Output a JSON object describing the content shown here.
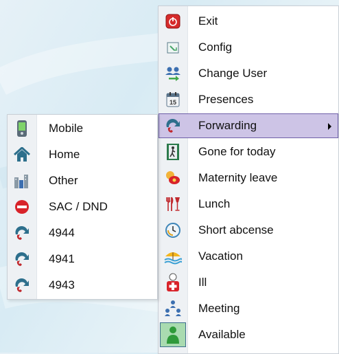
{
  "main_menu": {
    "items": [
      {
        "label": "Exit",
        "icon": "power-icon"
      },
      {
        "label": "Config",
        "icon": "config-icon"
      },
      {
        "label": "Change User",
        "icon": "change-user-icon"
      },
      {
        "label": "Presences",
        "icon": "calendar-icon",
        "icon_text": "15"
      },
      {
        "label": "Forwarding",
        "icon": "forwarding-phone-icon",
        "highlighted": true,
        "has_submenu": true
      },
      {
        "label": "Gone for today",
        "icon": "exit-door-icon"
      },
      {
        "label": "Maternity leave",
        "icon": "pacifier-icon"
      },
      {
        "label": "Lunch",
        "icon": "cutlery-icon"
      },
      {
        "label": "Short abcense",
        "icon": "clock-icon"
      },
      {
        "label": "Vacation",
        "icon": "beach-umbrella-icon"
      },
      {
        "label": "Ill",
        "icon": "medical-cross-icon"
      },
      {
        "label": "Meeting",
        "icon": "meeting-people-icon"
      },
      {
        "label": "Available",
        "icon": "available-person-icon",
        "selected": true
      }
    ]
  },
  "sub_menu": {
    "items": [
      {
        "label": "Mobile",
        "icon": "mobile-phone-icon"
      },
      {
        "label": "Home",
        "icon": "home-icon"
      },
      {
        "label": "Other",
        "icon": "buildings-icon"
      },
      {
        "label": "SAC / DND",
        "icon": "do-not-disturb-icon"
      },
      {
        "label": "4944",
        "icon": "forwarding-phone-icon"
      },
      {
        "label": "4941",
        "icon": "forwarding-phone-icon"
      },
      {
        "label": "4943",
        "icon": "forwarding-phone-icon"
      }
    ]
  },
  "colors": {
    "highlight": "#cdc4e6",
    "highlight_border": "#6e5fa8",
    "selected_icon_bg": "#a9dbb0"
  }
}
